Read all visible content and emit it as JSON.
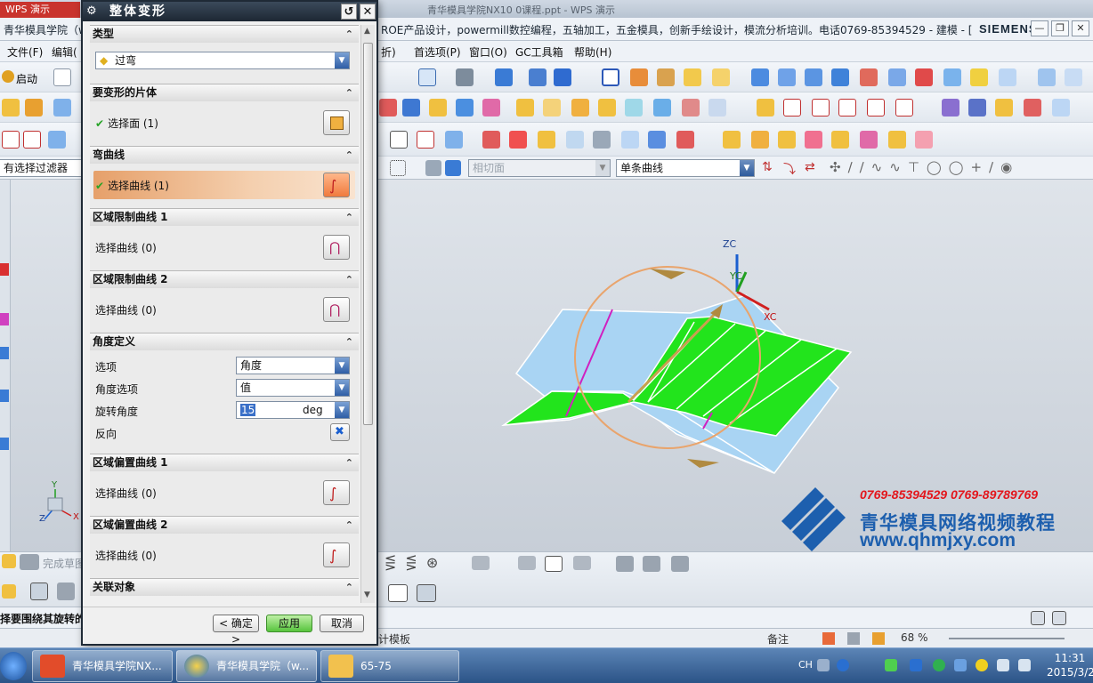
{
  "wps": {
    "tab": "WPS 演示",
    "window_title": "青华模具学院NX10 0课程.ppt - WPS 演示"
  },
  "nx": {
    "title_left": "青华模具学院（w",
    "title_right": "ROE产品设计，powermill数控编程，五轴加工，五金模具，创新手绘设计，模流分析培训。电话0769-85394529 - 建模 - [",
    "brand": "SIEMENS",
    "menus_left": [
      "文件(F)",
      "编辑("
    ],
    "menus_right": [
      "折)",
      "首选项(P)",
      "窗口(O)",
      "GC工具箱",
      "帮助(H)"
    ],
    "start_label": "启动",
    "filter_label": "有选择过滤器",
    "tangent_combo": "相切面",
    "curve_rule_combo": "单条曲线",
    "finish_sketch": "完成草图",
    "status_text": "择要围绕其旋转的",
    "triad": {
      "x": "X",
      "y": "Y",
      "z": "Z"
    },
    "wcs": {
      "xc": "XC",
      "yc": "YC",
      "zc": "ZC"
    }
  },
  "dialog": {
    "title": "整体变形",
    "sections": {
      "type": {
        "header": "类型",
        "value": "过弯"
      },
      "faces": {
        "header": "要变形的片体",
        "label": "选择面 (1)"
      },
      "bend_curve": {
        "header": "弯曲线",
        "label": "选择曲线 (1)"
      },
      "region1": {
        "header": "区域限制曲线 1",
        "label": "选择曲线 (0)"
      },
      "region2": {
        "header": "区域限制曲线 2",
        "label": "选择曲线 (0)"
      },
      "angle": {
        "header": "角度定义",
        "option_label": "选项",
        "option_value": "角度",
        "angle_option_label": "角度选项",
        "angle_option_value": "值",
        "rotation_label": "旋转角度",
        "rotation_value": "15",
        "rotation_unit": "deg",
        "reverse_label": "反向"
      },
      "offset1": {
        "header": "区域偏置曲线 1",
        "label": "选择曲线 (0)"
      },
      "offset2": {
        "header": "区域偏置曲线 2",
        "label": "选择曲线 (0)"
      },
      "assoc": {
        "header": "关联对象"
      }
    },
    "buttons": {
      "ok": "< 确定 >",
      "apply": "应用",
      "cancel": "取消"
    }
  },
  "watermark": {
    "phones": "0769-85394529  0769-89789769",
    "name": "青华模具网络视频教程",
    "url": "www.qhmjxy.com"
  },
  "wps_bottom": {
    "template": "计模板",
    "note": "备注",
    "zoom": "68 %"
  },
  "taskbar": {
    "items": [
      "青华模具学院NX...",
      "青华模具学院（w...",
      "65-75"
    ],
    "ime": "CH",
    "time": "11:31",
    "date": "2015/3/2"
  },
  "colors": {
    "face_green": "#22e41c",
    "face_blue": "#a9d4f3",
    "accent_orange": "#e9a46c"
  }
}
